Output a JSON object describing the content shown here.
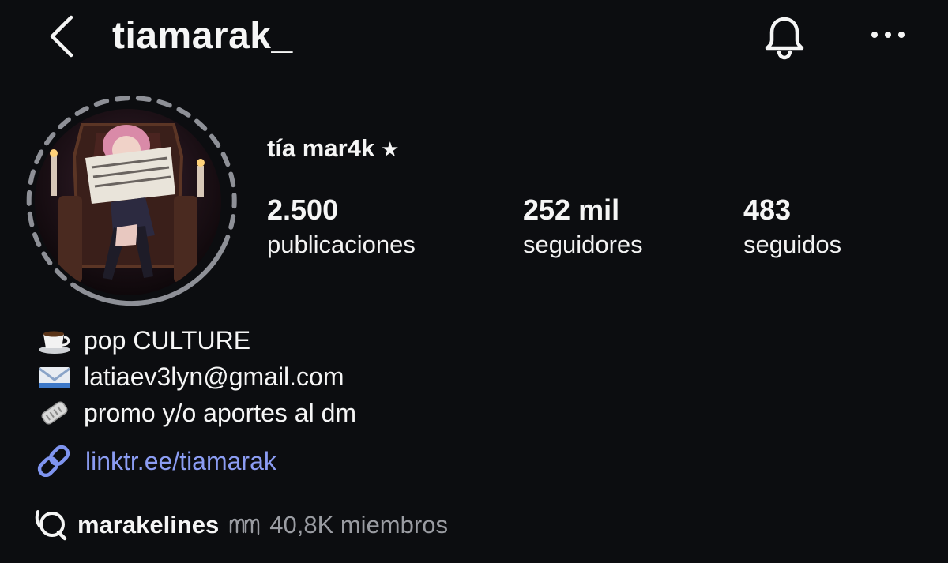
{
  "header": {
    "username": "tiamarak_",
    "icons": {
      "back": "chevron-left-icon",
      "notifications": "bell-icon",
      "more": "more-horizontal-icon"
    }
  },
  "profile": {
    "display_name": "tía mar4k",
    "name_suffix": "★",
    "avatar": "profile-avatar-illustration",
    "stats": [
      {
        "value": "2.500",
        "label": "publicaciones"
      },
      {
        "value": "252 mil",
        "label": "seguidores"
      },
      {
        "value": "483",
        "label": "seguidos"
      }
    ]
  },
  "bio": {
    "lines": [
      {
        "icon": "coffee-cup-icon",
        "text": "pop CULTURE"
      },
      {
        "icon": "envelope-icon",
        "text": "latiaev3lyn@gmail.com"
      },
      {
        "icon": "newspaper-icon",
        "text": "promo y/o aportes al dm"
      }
    ],
    "link": {
      "icon": "link-icon",
      "text": "linktr.ee/tiamarak"
    }
  },
  "channel": {
    "icon": "broadcast-channel-icon",
    "name": "marakelines",
    "mark_icon": "squiggle-icon",
    "members": "40,8K miembros"
  },
  "colors": {
    "background": "#0c0d10",
    "text": "#f5f5f5",
    "link": "#8b9cf2",
    "muted": "#9a9ca2",
    "story_ring": "#8e9097"
  }
}
